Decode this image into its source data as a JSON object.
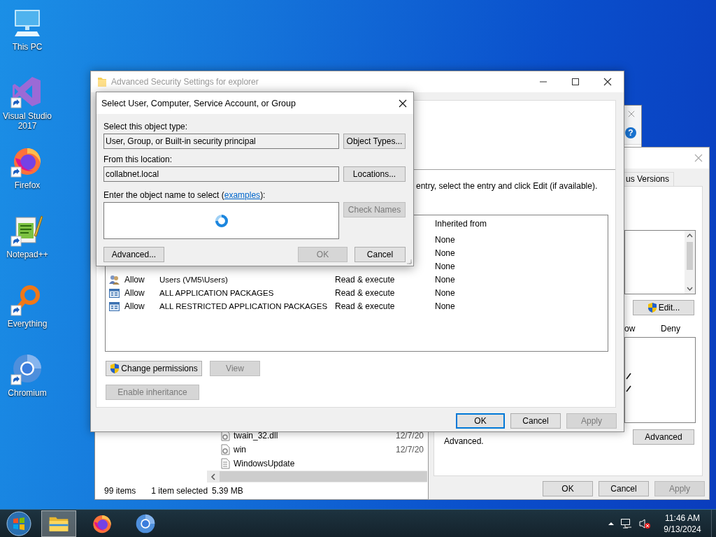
{
  "desktop_icons": [
    {
      "label": "This PC",
      "kind": "pc",
      "shortcut": false
    },
    {
      "label": "Visual Studio 2017",
      "kind": "visual_studio",
      "shortcut": true
    },
    {
      "label": "Firefox",
      "kind": "firefox",
      "shortcut": true
    },
    {
      "label": "Notepad++",
      "kind": "notepad",
      "shortcut": true
    },
    {
      "label": "Everything",
      "kind": "everything",
      "shortcut": true
    },
    {
      "label": "Chromium",
      "kind": "chromium",
      "shortcut": true
    }
  ],
  "explorer": {
    "help_glyph": "?",
    "files": [
      {
        "name": "twain_32.dll",
        "date": "12/7/20",
        "kind": "dll"
      },
      {
        "name": "win",
        "date": "12/7/20",
        "kind": "ini"
      },
      {
        "name": "WindowsUpdate",
        "kind": "log"
      }
    ],
    "status_bar": {
      "item_count": "99 items",
      "selection": "1 item selected",
      "size": "5.39 MB"
    }
  },
  "properties": {
    "tabs": [
      {
        "label": "us Versions",
        "selected": false
      }
    ],
    "edit_button": {
      "label": "Edit...",
      "shield": true
    },
    "permission_columns": [
      "ow",
      "Deny"
    ],
    "permissions": [
      {
        "allow": true
      },
      {
        "allow": true
      }
    ],
    "note": "Advanced.",
    "advanced_button": {
      "label": "Advanced",
      "disabled": false
    },
    "buttons": [
      {
        "label": "OK",
        "disabled": false
      },
      {
        "label": "Cancel",
        "disabled": false
      },
      {
        "label": "Apply",
        "disabled": true
      }
    ]
  },
  "advanced_security": {
    "title": "Advanced Security Settings for explorer",
    "active": false,
    "instructions": "entry, select the entry and click Edit (if available).",
    "columns": [
      "Inherited from"
    ],
    "entries": [
      {
        "inherited_from": "None"
      },
      {
        "inherited_from": "None"
      },
      {
        "inherited_from": "None"
      },
      {
        "kind": "group",
        "type": "Allow",
        "principal": "Users (VM5\\Users)",
        "access": "Read & execute",
        "inherited_from": "None"
      },
      {
        "kind": "package",
        "type": "Allow",
        "principal": "ALL APPLICATION PACKAGES",
        "access": "Read & execute",
        "inherited_from": "None"
      },
      {
        "kind": "package",
        "type": "Allow",
        "principal": "ALL RESTRICTED APPLICATION PACKAGES",
        "access": "Read & execute",
        "inherited_from": "None"
      }
    ],
    "entry_buttons": [
      {
        "label": "Change permissions",
        "shield": true,
        "disabled": false
      },
      {
        "label": "View",
        "disabled": true
      }
    ],
    "inheritance_button": {
      "label": "Enable inheritance",
      "disabled": true
    },
    "buttons": [
      {
        "label": "OK",
        "default": true,
        "disabled": false
      },
      {
        "label": "Cancel",
        "default": false,
        "disabled": false
      },
      {
        "label": "Apply",
        "default": false,
        "disabled": true
      }
    ]
  },
  "select_dialog": {
    "title": "Select User, Computer, Service Account, or Group",
    "active": true,
    "fields": [
      {
        "label": "Select this object type:",
        "value": "User, Group, or Built-in security principal",
        "button": {
          "label": "Object Types...",
          "disabled": false
        }
      },
      {
        "label": "From this location:",
        "value": "collabnet.local",
        "button": {
          "label": "Locations...",
          "disabled": false
        }
      }
    ],
    "name_label": {
      "text_before": "Enter the object name to select (",
      "link": "examples",
      "text_after": "):"
    },
    "name_field": {
      "busy": true
    },
    "check_button": {
      "label": "Check Names",
      "disabled": true
    },
    "buttons": [
      {
        "label": "Advanced...",
        "disabled": false
      },
      {
        "label": "OK",
        "disabled": true
      },
      {
        "label": "Cancel",
        "disabled": false
      }
    ]
  },
  "taskbar": {
    "apps": [
      {
        "kind": "explorer",
        "selected": true
      },
      {
        "kind": "firefox",
        "selected": false
      },
      {
        "kind": "chromium",
        "selected": false
      }
    ],
    "clock": {
      "time": "11:46 AM",
      "date": "9/13/2024"
    }
  }
}
